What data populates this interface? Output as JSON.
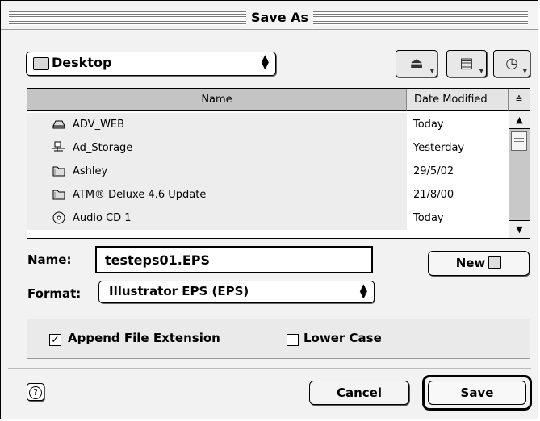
{
  "window": {
    "title": "Save As",
    "corner_mark": ":"
  },
  "location": {
    "selected": "Desktop"
  },
  "toolbar_icons": [
    "drive-icon",
    "favorites-icon",
    "recent-items-icon"
  ],
  "file_list": {
    "columns": {
      "name": "Name",
      "date": "Date Modified",
      "sort_glyph": "≙"
    },
    "rows": [
      {
        "name": "ADV_WEB",
        "date": "Today",
        "icon": "hard-drive-icon"
      },
      {
        "name": "Ad_Storage",
        "date": "Yesterday",
        "icon": "network-volume-icon"
      },
      {
        "name": "Ashley",
        "date": "29/5/02",
        "icon": "folder-icon"
      },
      {
        "name": "ATM® Deluxe 4.6 Update",
        "date": "21/8/00",
        "icon": "folder-icon"
      },
      {
        "name": "Audio CD 1",
        "date": "Today",
        "icon": "cd-icon"
      }
    ]
  },
  "name_field": {
    "label": "Name:",
    "value": "testeps01.EPS"
  },
  "new_button": {
    "label": "New"
  },
  "format": {
    "label": "Format:",
    "selected": "Illustrator EPS (EPS)"
  },
  "options": {
    "append_extension": {
      "label": "Append File Extension",
      "checked": true
    },
    "lower_case": {
      "label": "Lower Case",
      "checked": false
    }
  },
  "buttons": {
    "help": "?",
    "cancel": "Cancel",
    "save": "Save"
  }
}
